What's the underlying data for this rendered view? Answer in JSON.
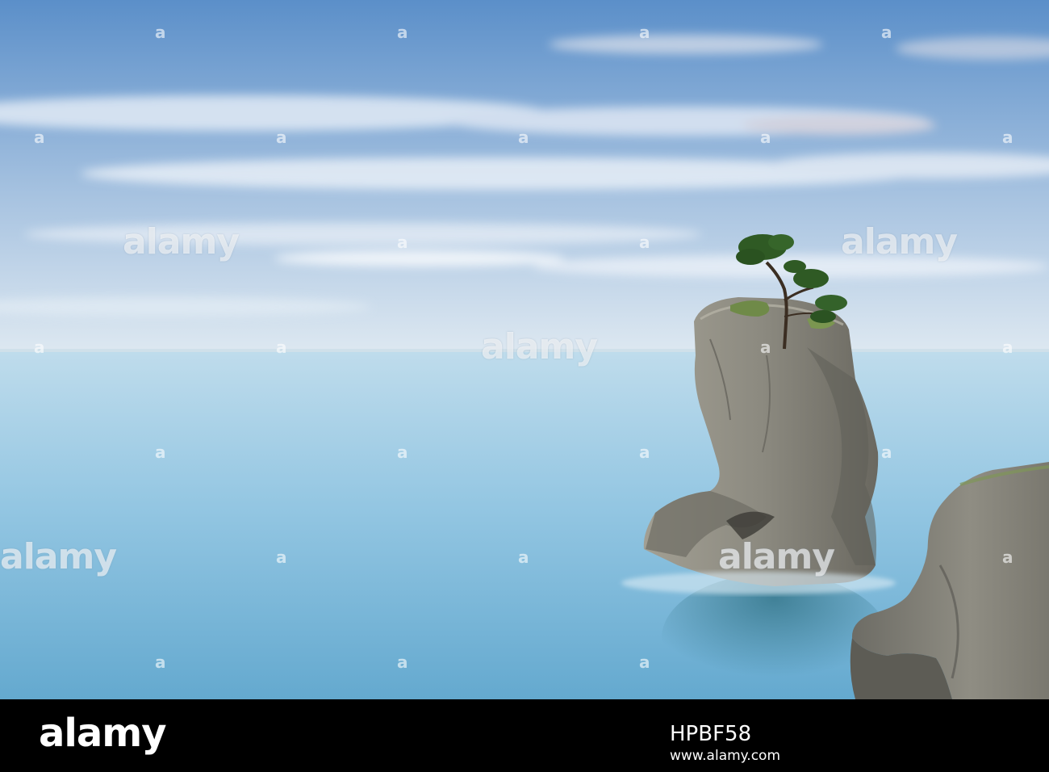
{
  "photo": {
    "colors": {
      "sky_top": "#5b8fc9",
      "sky_mid": "#9fbfe0",
      "horizon": "#dbe8f2",
      "sea_top": "#b9d7ea",
      "sea_bottom": "#5ea9cf",
      "rock": "#8c8a80",
      "rock_dark": "#5d5c55",
      "tree": "#2f5a24"
    },
    "watermark": {
      "word": "alamy",
      "mark": "a"
    }
  },
  "footer": {
    "logo": "alamy",
    "image_id": "HPBF58",
    "url": "www.alamy.com"
  }
}
